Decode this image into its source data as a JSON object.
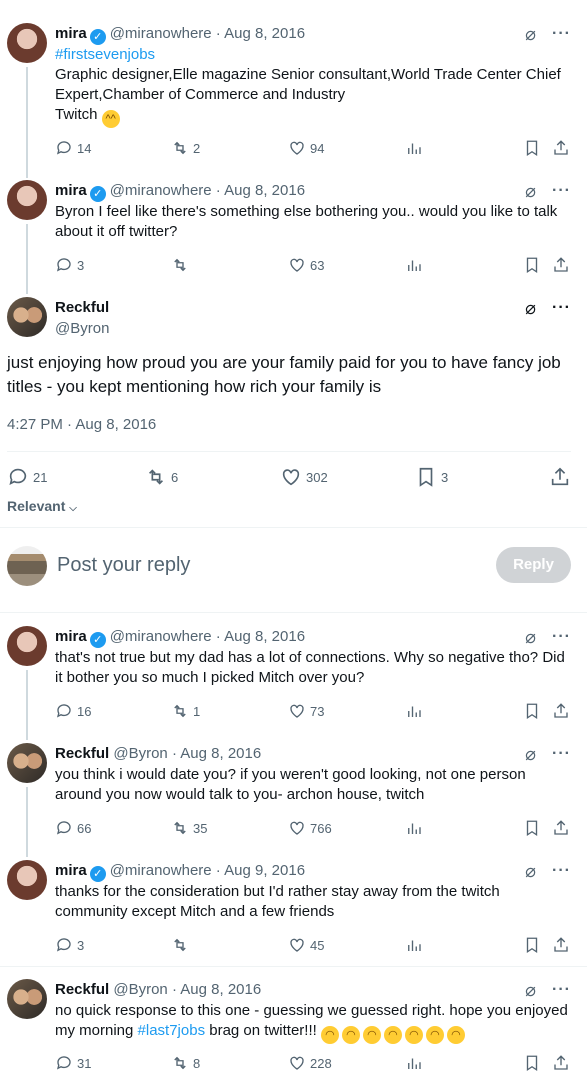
{
  "tweets": [
    {
      "name": "mira",
      "verified": true,
      "handle": "@miranowhere",
      "date": "Aug 8, 2016",
      "hashtag": "#firstsevenjobs",
      "text": "Graphic designer,Elle magazine Senior consultant,World Trade Center Chief Expert,Chamber of Commerce and Industry",
      "text2": "Twitch",
      "emoji": "sweat-smile-emoji",
      "replies": "14",
      "reposts": "2",
      "likes": "94"
    },
    {
      "name": "mira",
      "verified": true,
      "handle": "@miranowhere",
      "date": "Aug 8, 2016",
      "text": "Byron I feel like there's something else bothering you.. would you like to talk about it off twitter?",
      "replies": "3",
      "reposts": "",
      "likes": "63"
    }
  ],
  "focal": {
    "name": "Reckful",
    "handle": "@Byron",
    "text": "just enjoying how proud you are your family paid for you to have fancy job titles - you kept mentioning how rich your family is",
    "timestamp": "4:27 PM · Aug 8, 2016",
    "replies": "21",
    "reposts": "6",
    "likes": "302",
    "bookmarks": "3"
  },
  "sort_label": "Relevant",
  "reply_placeholder": "Post your reply",
  "reply_button": "Reply",
  "replies": [
    {
      "name": "mira",
      "verified": true,
      "handle": "@miranowhere",
      "date": "Aug 8, 2016",
      "text": "that's not true but my dad has a lot of connections. Why so negative tho? Did it bother you so much I picked Mitch over you?",
      "replies": "16",
      "reposts": "1",
      "likes": "73"
    },
    {
      "name": "Reckful",
      "verified": false,
      "handle": "@Byron",
      "date": "Aug 8, 2016",
      "text": "you think i would date you?  if you weren't good looking, not one person around you now would talk to you- archon house, twitch",
      "replies": "66",
      "reposts": "35",
      "likes": "766"
    },
    {
      "name": "mira",
      "verified": true,
      "handle": "@miranowhere",
      "date": "Aug 9, 2016",
      "text": "thanks for the consideration but I'd rather stay away from the twitch community except Mitch and a few friends",
      "replies": "3",
      "reposts": "",
      "likes": "45"
    },
    {
      "name": "Reckful",
      "verified": false,
      "handle": "@Byron",
      "date": "Aug 8, 2016",
      "text": "no quick response to this one - guessing we guessed right.  hope you enjoyed my morning ",
      "hashtag": "#last7jobs",
      "text2": " brag on twitter!!! ",
      "emoji": "upside-down-face-emoji",
      "replies": "31",
      "reposts": "8",
      "likes": "228"
    }
  ],
  "sep": " · ",
  "colors": {
    "link": "#1d9bf0",
    "muted": "#536471",
    "verified": "#1d9bf0"
  }
}
